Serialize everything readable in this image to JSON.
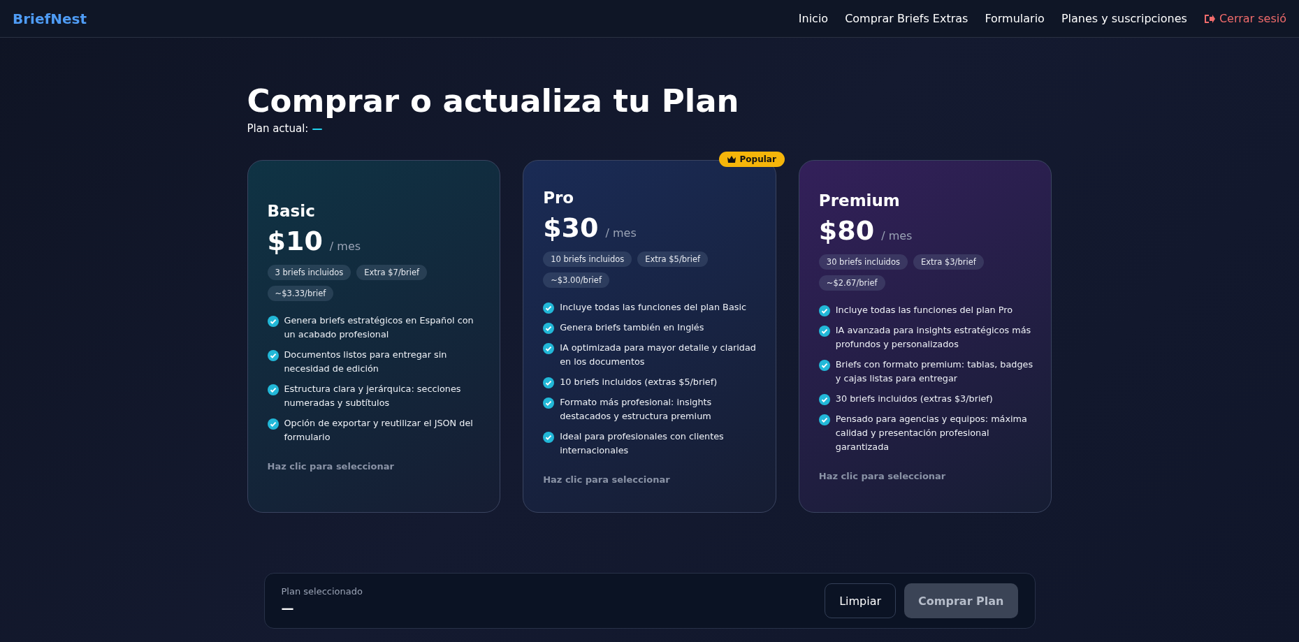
{
  "nav": {
    "brand": "BriefNest",
    "links": [
      {
        "label": "Inicio"
      },
      {
        "label": "Comprar Briefs Extras"
      },
      {
        "label": "Formulario"
      },
      {
        "label": "Planes y suscripciones"
      }
    ],
    "logout": "Cerrar sesió"
  },
  "heading": {
    "title": "Comprar o actualiza tu Plan",
    "current_label": "Plan actual:",
    "current_value": "—"
  },
  "plans": [
    {
      "name": "Basic",
      "price": "$10",
      "period": "/ mes",
      "color": "#0f3344",
      "popular": false,
      "chips": [
        "3 briefs incluidos",
        "Extra $7/brief",
        "~$3.33/brief"
      ],
      "features": [
        "Genera briefs estratégicos en Español con un acabado profesional",
        "Documentos listos para entregar sin necesidad de edición",
        "Estructura clara y jerárquica: secciones numeradas y subtítulos",
        "Opción de exportar y reutilizar el JSON del formulario"
      ],
      "hint": "Haz clic para seleccionar"
    },
    {
      "name": "Pro",
      "price": "$30",
      "period": "/ mes",
      "color": "#1a2b55",
      "popular": true,
      "badge": "Popular",
      "chips": [
        "10 briefs incluidos",
        "Extra $5/brief",
        "~$3.00/brief"
      ],
      "features": [
        "Incluye todas las funciones del plan Basic",
        "Genera briefs también en Inglés",
        "IA optimizada para mayor detalle y claridad en los documentos",
        "10 briefs incluidos (extras $5/brief)",
        "Formato más profesional: insights destacados y estructura premium",
        "Ideal para profesionales con clientes internacionales"
      ],
      "hint": "Haz clic para seleccionar"
    },
    {
      "name": "Premium",
      "price": "$80",
      "period": "/ mes",
      "color": "#33205a",
      "popular": false,
      "chips": [
        "30 briefs incluidos",
        "Extra $3/brief",
        "~$2.67/brief"
      ],
      "features": [
        "Incluye todas las funciones del plan Pro",
        "IA avanzada para insights estratégicos más profundos y personalizados",
        "Briefs con formato premium: tablas, badges y cajas listas para entregar",
        "30 briefs incluidos (extras $3/brief)",
        "Pensado para agencias y equipos: máxima calidad y presentación profesional garantizada"
      ],
      "hint": "Haz clic para seleccionar"
    }
  ],
  "footer": {
    "label": "Plan seleccionado",
    "value": "—",
    "clear": "Limpiar",
    "buy": {
      "label": "Comprar Plan",
      "disabled": true
    }
  }
}
